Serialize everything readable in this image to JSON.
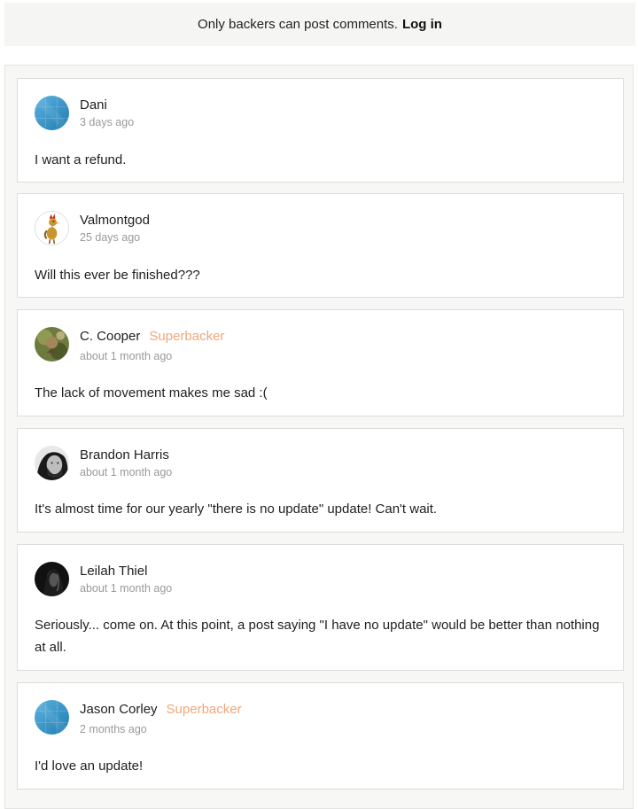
{
  "notice": {
    "text": "Only backers can post comments.",
    "login_label": "Log in"
  },
  "comments": [
    {
      "author": "Dani",
      "badge": "",
      "time": "3 days ago",
      "body": "I want a refund.",
      "avatar": "default-blue-avatar"
    },
    {
      "author": "Valmontgod",
      "badge": "",
      "time": "25 days ago",
      "body": "Will this ever be finished???",
      "avatar": "rooster-cartoon-avatar"
    },
    {
      "author": "C. Cooper",
      "badge": "Superbacker",
      "time": "about 1 month ago",
      "body": "The lack of movement makes me sad :(",
      "avatar": "photo-avatar"
    },
    {
      "author": "Brandon Harris",
      "badge": "",
      "time": "about 1 month ago",
      "body": "It's almost time for our yearly \"there is no update\" update! Can't wait.",
      "avatar": "photo-avatar"
    },
    {
      "author": "Leilah Thiel",
      "badge": "",
      "time": "about 1 month ago",
      "body": "Seriously... come on. At this point, a post saying \"I have no update\" would be better than nothing at all.",
      "avatar": "photo-avatar"
    },
    {
      "author": "Jason Corley",
      "badge": "Superbacker",
      "time": "2 months ago",
      "body": "I'd love an update!",
      "avatar": "default-blue-avatar"
    }
  ],
  "colors": {
    "badge": "#f0a77b",
    "time": "#9a9a9a",
    "notice_bg": "#f5f5f3",
    "avatar_blue": "#3a9bd0"
  }
}
